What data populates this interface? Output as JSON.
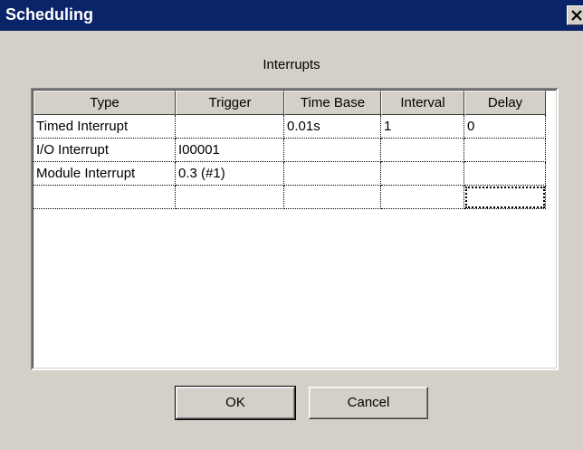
{
  "window": {
    "title": "Scheduling"
  },
  "group": {
    "label": "Interrupts"
  },
  "table": {
    "headers": [
      "Type",
      "Trigger",
      "Time Base",
      "Interval",
      "Delay"
    ],
    "rows": [
      [
        "Timed Interrupt",
        "",
        "0.01s",
        "1",
        "0"
      ],
      [
        "I/O Interrupt",
        "I00001",
        "",
        "",
        ""
      ],
      [
        "Module Interrupt",
        "0.3 (#1)",
        "",
        "",
        ""
      ],
      [
        "",
        "",
        "",
        "",
        ""
      ]
    ]
  },
  "buttons": {
    "ok_label": "OK",
    "cancel_label": "Cancel"
  },
  "icons": {
    "close": "close-icon"
  },
  "colors": {
    "titlebar": "#0a246a",
    "face": "#d4d0c8"
  }
}
